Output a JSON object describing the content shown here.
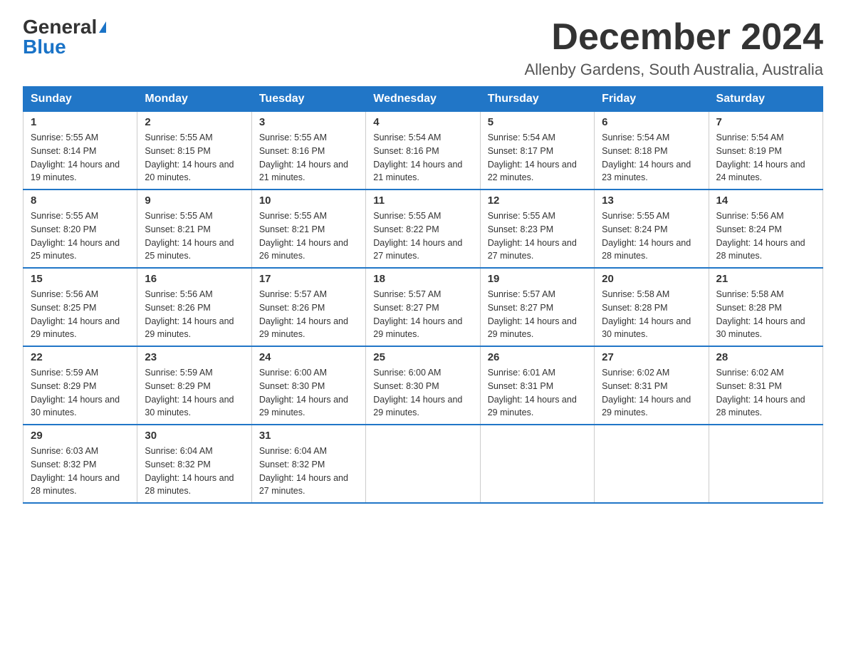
{
  "logo": {
    "general": "General",
    "blue": "Blue"
  },
  "title": "December 2024",
  "location": "Allenby Gardens, South Australia, Australia",
  "weekdays": [
    "Sunday",
    "Monday",
    "Tuesday",
    "Wednesday",
    "Thursday",
    "Friday",
    "Saturday"
  ],
  "weeks": [
    [
      {
        "day": "1",
        "sunrise": "5:55 AM",
        "sunset": "8:14 PM",
        "daylight": "14 hours and 19 minutes."
      },
      {
        "day": "2",
        "sunrise": "5:55 AM",
        "sunset": "8:15 PM",
        "daylight": "14 hours and 20 minutes."
      },
      {
        "day": "3",
        "sunrise": "5:55 AM",
        "sunset": "8:16 PM",
        "daylight": "14 hours and 21 minutes."
      },
      {
        "day": "4",
        "sunrise": "5:54 AM",
        "sunset": "8:16 PM",
        "daylight": "14 hours and 21 minutes."
      },
      {
        "day": "5",
        "sunrise": "5:54 AM",
        "sunset": "8:17 PM",
        "daylight": "14 hours and 22 minutes."
      },
      {
        "day": "6",
        "sunrise": "5:54 AM",
        "sunset": "8:18 PM",
        "daylight": "14 hours and 23 minutes."
      },
      {
        "day": "7",
        "sunrise": "5:54 AM",
        "sunset": "8:19 PM",
        "daylight": "14 hours and 24 minutes."
      }
    ],
    [
      {
        "day": "8",
        "sunrise": "5:55 AM",
        "sunset": "8:20 PM",
        "daylight": "14 hours and 25 minutes."
      },
      {
        "day": "9",
        "sunrise": "5:55 AM",
        "sunset": "8:21 PM",
        "daylight": "14 hours and 25 minutes."
      },
      {
        "day": "10",
        "sunrise": "5:55 AM",
        "sunset": "8:21 PM",
        "daylight": "14 hours and 26 minutes."
      },
      {
        "day": "11",
        "sunrise": "5:55 AM",
        "sunset": "8:22 PM",
        "daylight": "14 hours and 27 minutes."
      },
      {
        "day": "12",
        "sunrise": "5:55 AM",
        "sunset": "8:23 PM",
        "daylight": "14 hours and 27 minutes."
      },
      {
        "day": "13",
        "sunrise": "5:55 AM",
        "sunset": "8:24 PM",
        "daylight": "14 hours and 28 minutes."
      },
      {
        "day": "14",
        "sunrise": "5:56 AM",
        "sunset": "8:24 PM",
        "daylight": "14 hours and 28 minutes."
      }
    ],
    [
      {
        "day": "15",
        "sunrise": "5:56 AM",
        "sunset": "8:25 PM",
        "daylight": "14 hours and 29 minutes."
      },
      {
        "day": "16",
        "sunrise": "5:56 AM",
        "sunset": "8:26 PM",
        "daylight": "14 hours and 29 minutes."
      },
      {
        "day": "17",
        "sunrise": "5:57 AM",
        "sunset": "8:26 PM",
        "daylight": "14 hours and 29 minutes."
      },
      {
        "day": "18",
        "sunrise": "5:57 AM",
        "sunset": "8:27 PM",
        "daylight": "14 hours and 29 minutes."
      },
      {
        "day": "19",
        "sunrise": "5:57 AM",
        "sunset": "8:27 PM",
        "daylight": "14 hours and 29 minutes."
      },
      {
        "day": "20",
        "sunrise": "5:58 AM",
        "sunset": "8:28 PM",
        "daylight": "14 hours and 30 minutes."
      },
      {
        "day": "21",
        "sunrise": "5:58 AM",
        "sunset": "8:28 PM",
        "daylight": "14 hours and 30 minutes."
      }
    ],
    [
      {
        "day": "22",
        "sunrise": "5:59 AM",
        "sunset": "8:29 PM",
        "daylight": "14 hours and 30 minutes."
      },
      {
        "day": "23",
        "sunrise": "5:59 AM",
        "sunset": "8:29 PM",
        "daylight": "14 hours and 30 minutes."
      },
      {
        "day": "24",
        "sunrise": "6:00 AM",
        "sunset": "8:30 PM",
        "daylight": "14 hours and 29 minutes."
      },
      {
        "day": "25",
        "sunrise": "6:00 AM",
        "sunset": "8:30 PM",
        "daylight": "14 hours and 29 minutes."
      },
      {
        "day": "26",
        "sunrise": "6:01 AM",
        "sunset": "8:31 PM",
        "daylight": "14 hours and 29 minutes."
      },
      {
        "day": "27",
        "sunrise": "6:02 AM",
        "sunset": "8:31 PM",
        "daylight": "14 hours and 29 minutes."
      },
      {
        "day": "28",
        "sunrise": "6:02 AM",
        "sunset": "8:31 PM",
        "daylight": "14 hours and 28 minutes."
      }
    ],
    [
      {
        "day": "29",
        "sunrise": "6:03 AM",
        "sunset": "8:32 PM",
        "daylight": "14 hours and 28 minutes."
      },
      {
        "day": "30",
        "sunrise": "6:04 AM",
        "sunset": "8:32 PM",
        "daylight": "14 hours and 28 minutes."
      },
      {
        "day": "31",
        "sunrise": "6:04 AM",
        "sunset": "8:32 PM",
        "daylight": "14 hours and 27 minutes."
      },
      null,
      null,
      null,
      null
    ]
  ]
}
